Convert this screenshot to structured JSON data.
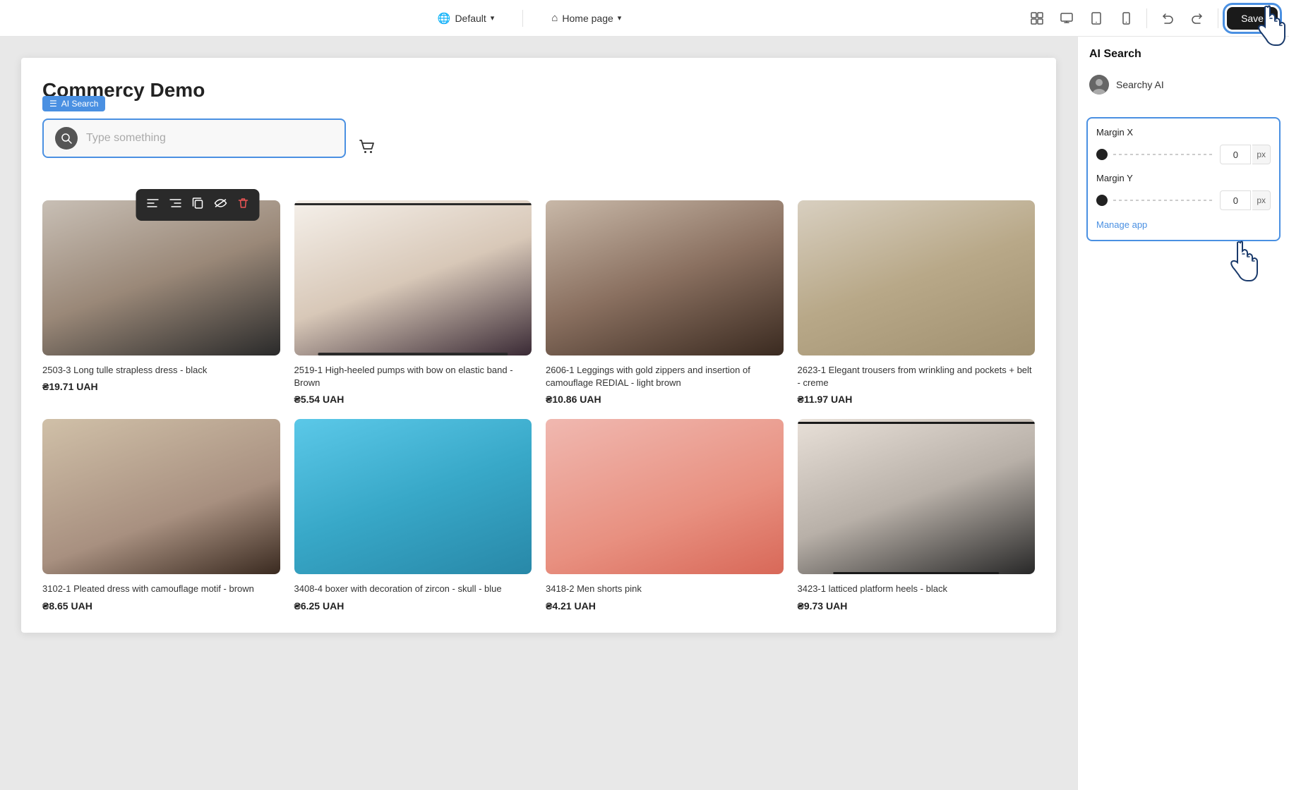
{
  "topbar": {
    "language": "Default",
    "page": "Home page",
    "save_label": "Save",
    "globe_icon": "🌐",
    "home_icon": "⌂",
    "chevron_down": "▾"
  },
  "ai_search": {
    "badge": "AI Search",
    "badge_icon": "☰",
    "placeholder": "Type something",
    "searchy_name": "Searchy AI",
    "panel_title": "AI Search"
  },
  "margins": {
    "section_label": "Margin",
    "margin_x_label": "Margin X",
    "margin_y_label": "Margin Y",
    "margin_x_value": "0",
    "margin_y_value": "0",
    "unit": "px",
    "manage_link": "Manage app"
  },
  "store": {
    "title": "Commercy Demo"
  },
  "products": [
    {
      "id": "1",
      "name": "2503-3 Long tulle strapless dress - black",
      "price": "₴19.71 UAH",
      "img_class": "img-dress-black"
    },
    {
      "id": "2",
      "name": "2519-1 High-heeled pumps with bow on elastic band - Brown",
      "price": "₴5.54 UAH",
      "img_class": "img-heels-brown"
    },
    {
      "id": "3",
      "name": "2606-1 Leggings with gold zippers and insertion of camouflage REDIAL - light brown",
      "price": "₴10.86 UAH",
      "img_class": "img-leggings"
    },
    {
      "id": "4",
      "name": "2623-1 Elegant trousers from wrinkling and pockets + belt - creme",
      "price": "₴11.97 UAH",
      "img_class": "img-trousers"
    },
    {
      "id": "5",
      "name": "3102-1 Pleated dress with camouflage motif - brown",
      "price": "₴8.65 UAH",
      "img_class": "img-pleated"
    },
    {
      "id": "6",
      "name": "3408-4 boxer with decoration of zircon - skull - blue",
      "price": "₴6.25 UAH",
      "img_class": "img-blue-dress"
    },
    {
      "id": "7",
      "name": "3418-2 Men shorts pink",
      "price": "₴4.21 UAH",
      "img_class": "img-pink-shorts"
    },
    {
      "id": "8",
      "name": "3423-1 latticed platform heels - black",
      "price": "₴9.73 UAH",
      "img_class": "img-black-heels"
    }
  ],
  "toolbar_icons": [
    "≡",
    "≡",
    "⬜",
    "⊘",
    "🗑"
  ]
}
